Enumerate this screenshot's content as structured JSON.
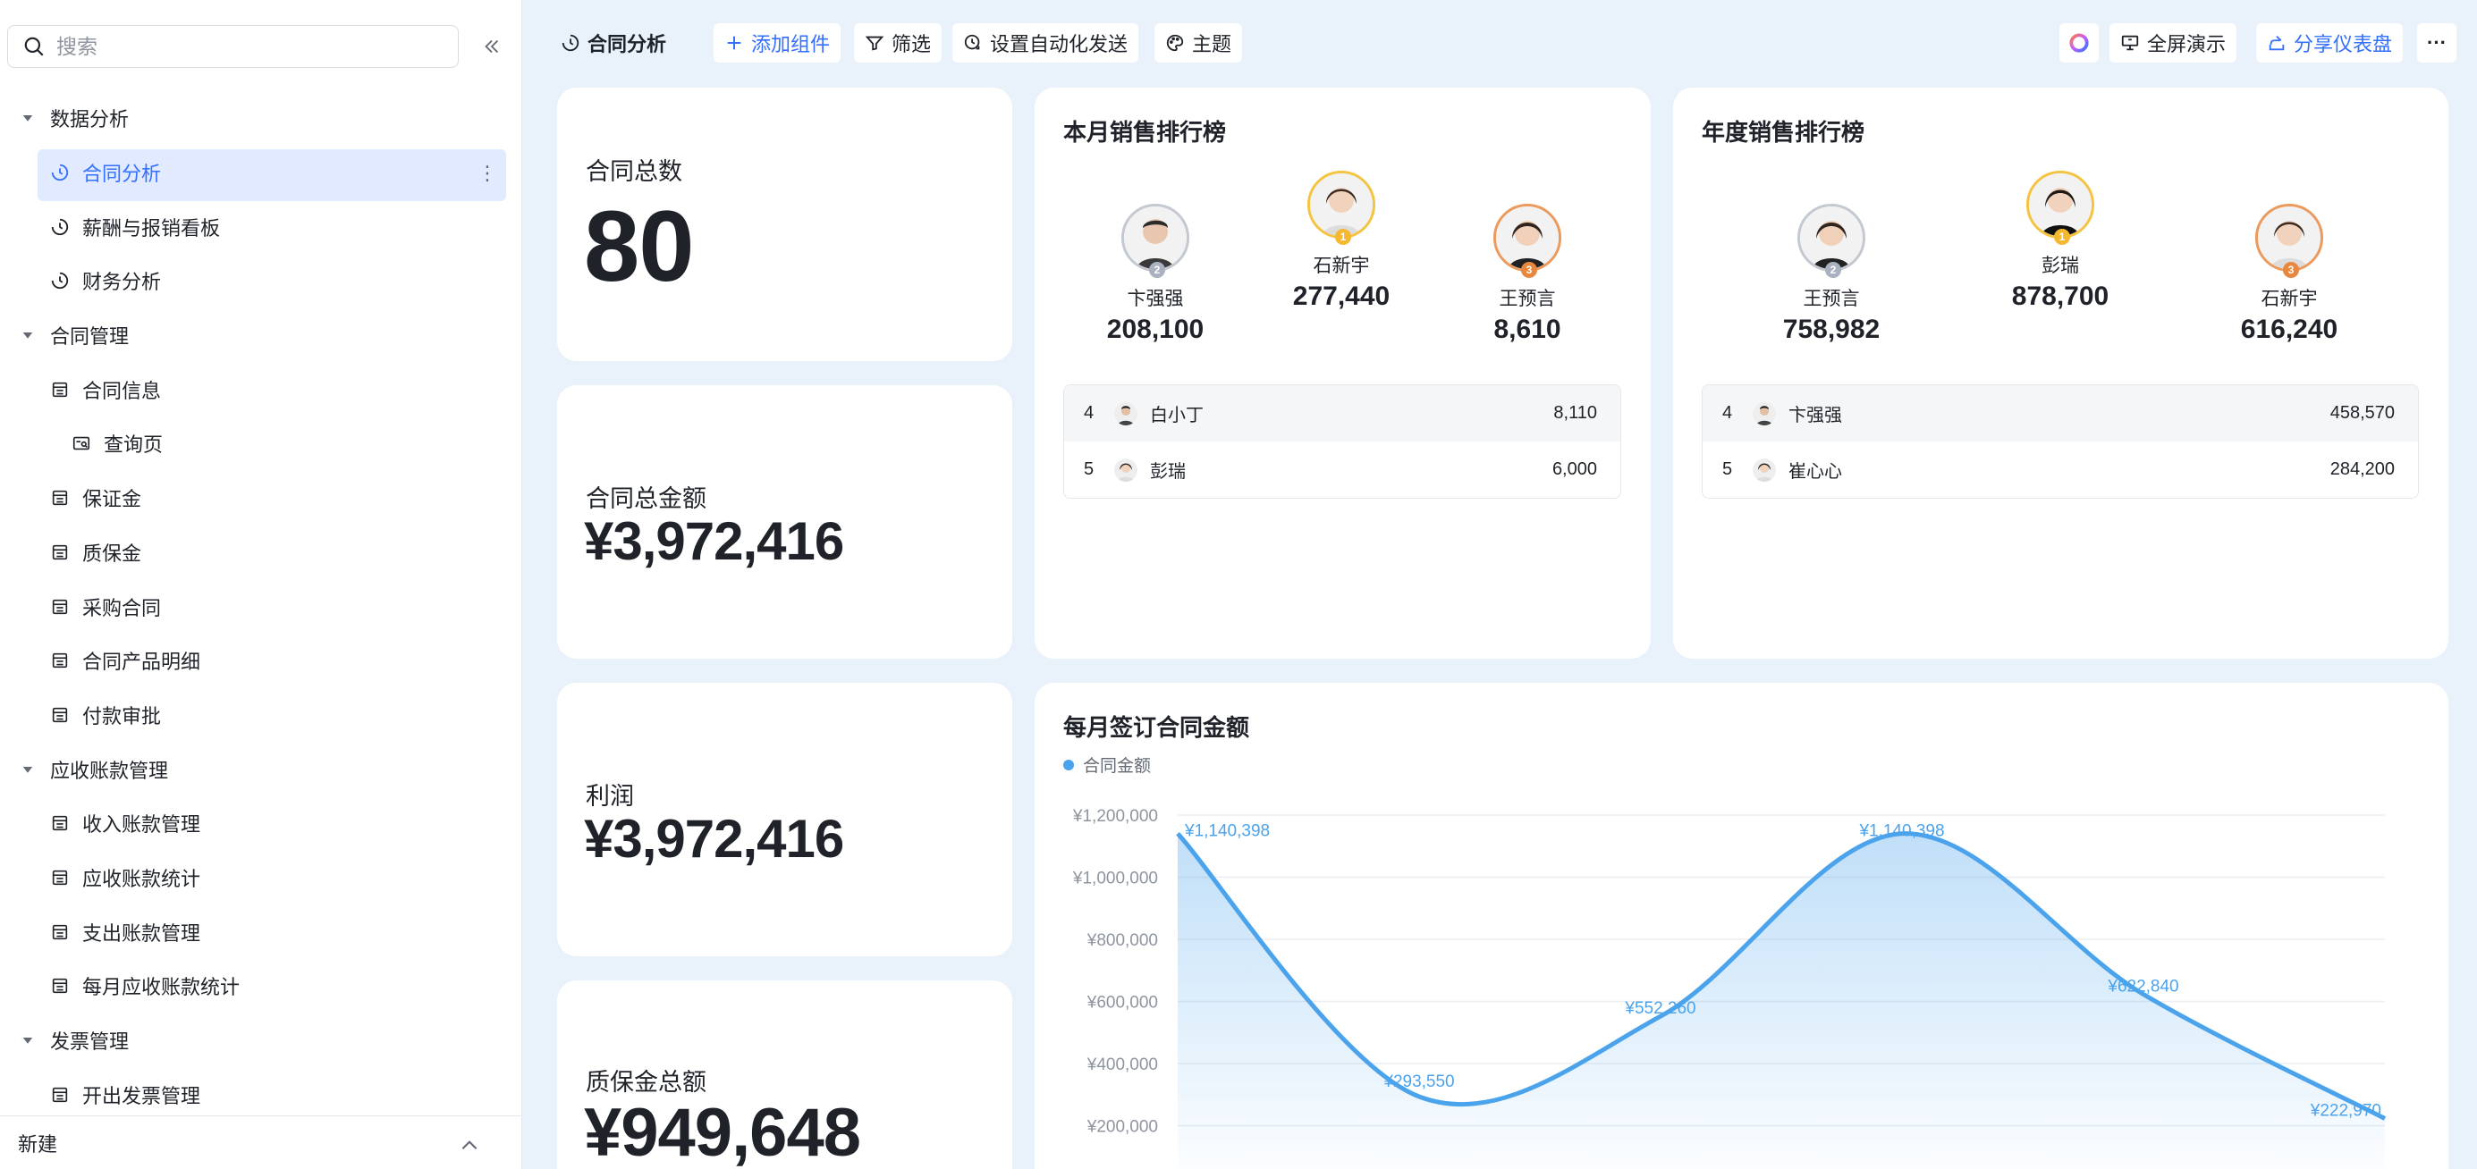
{
  "sidebar": {
    "search_placeholder": "搜索",
    "groups": [
      {
        "label": "数据分析",
        "items": [
          {
            "label": "合同分析",
            "icon": "dashboard-icon",
            "active": true
          },
          {
            "label": "薪酬与报销看板",
            "icon": "dashboard-icon"
          },
          {
            "label": "财务分析",
            "icon": "dashboard-icon"
          }
        ]
      },
      {
        "label": "合同管理",
        "items": [
          {
            "label": "合同信息",
            "icon": "table-icon"
          },
          {
            "label": "查询页",
            "icon": "query-icon",
            "sub": true
          },
          {
            "label": "保证金",
            "icon": "table-icon"
          },
          {
            "label": "质保金",
            "icon": "table-icon"
          },
          {
            "label": "采购合同",
            "icon": "table-icon"
          },
          {
            "label": "合同产品明细",
            "icon": "table-icon"
          },
          {
            "label": "付款审批",
            "icon": "table-icon"
          }
        ]
      },
      {
        "label": "应收账款管理",
        "items": [
          {
            "label": "收入账款管理",
            "icon": "table-icon"
          },
          {
            "label": "应收账款统计",
            "icon": "table-icon"
          },
          {
            "label": "支出账款管理",
            "icon": "table-icon"
          },
          {
            "label": "每月应收账款统计",
            "icon": "table-icon"
          }
        ]
      },
      {
        "label": "发票管理",
        "items": [
          {
            "label": "开出发票管理",
            "icon": "table-icon"
          }
        ]
      }
    ],
    "footer_label": "新建"
  },
  "toolbar": {
    "title": "合同分析",
    "add_component": "添加组件",
    "filter": "筛选",
    "auto_send": "设置自动化发送",
    "theme": "主题",
    "fullscreen": "全屏演示",
    "share": "分享仪表盘",
    "more": "···"
  },
  "stats": {
    "contract_count": {
      "label": "合同总数",
      "value": "80"
    },
    "contract_amount": {
      "label": "合同总金额",
      "value": "¥3,972,416"
    },
    "profit": {
      "label": "利润",
      "value": "¥3,972,416"
    },
    "warranty": {
      "label": "质保金总额",
      "value": "¥949,648"
    }
  },
  "monthly_rank": {
    "title": "本月销售排行榜",
    "first": {
      "name": "石新宇",
      "value": "277,440",
      "medal": "1"
    },
    "second": {
      "name": "卞强强",
      "value": "208,100",
      "medal": "2"
    },
    "third": {
      "name": "王预言",
      "value": "8,610",
      "medal": "3"
    },
    "rest": [
      {
        "rank": "4",
        "name": "白小丁",
        "value": "8,110"
      },
      {
        "rank": "5",
        "name": "彭瑞",
        "value": "6,000"
      }
    ]
  },
  "yearly_rank": {
    "title": "年度销售排行榜",
    "first": {
      "name": "彭瑞",
      "value": "878,700",
      "medal": "1"
    },
    "second": {
      "name": "王预言",
      "value": "758,982",
      "medal": "2"
    },
    "third": {
      "name": "石新宇",
      "value": "616,240",
      "medal": "3"
    },
    "rest": [
      {
        "rank": "4",
        "name": "卞强强",
        "value": "458,570"
      },
      {
        "rank": "5",
        "name": "崔心心",
        "value": "284,200"
      }
    ]
  },
  "colors": {
    "accent": "#3370ff",
    "line": "#4ba3ec",
    "active_bg": "#e1eaff",
    "page_bg": "#e9f1fb"
  },
  "chart_data": {
    "type": "area",
    "title": "每月签订合同金额",
    "series": [
      {
        "name": "合同金额",
        "values": [
          1140398,
          293550,
          552260,
          1140398,
          622840,
          222970
        ]
      }
    ],
    "data_labels": [
      "¥1,140,398",
      "¥293,550",
      "¥552,260",
      "¥1,140,398",
      "¥622,840",
      "¥222,970"
    ],
    "y_ticks": [
      "¥200,000",
      "¥400,000",
      "¥600,000",
      "¥800,000",
      "¥1,000,000",
      "¥1,200,000"
    ],
    "ylim": [
      0,
      1200000
    ],
    "grid": true,
    "legend": "top-left",
    "smooth": true
  }
}
